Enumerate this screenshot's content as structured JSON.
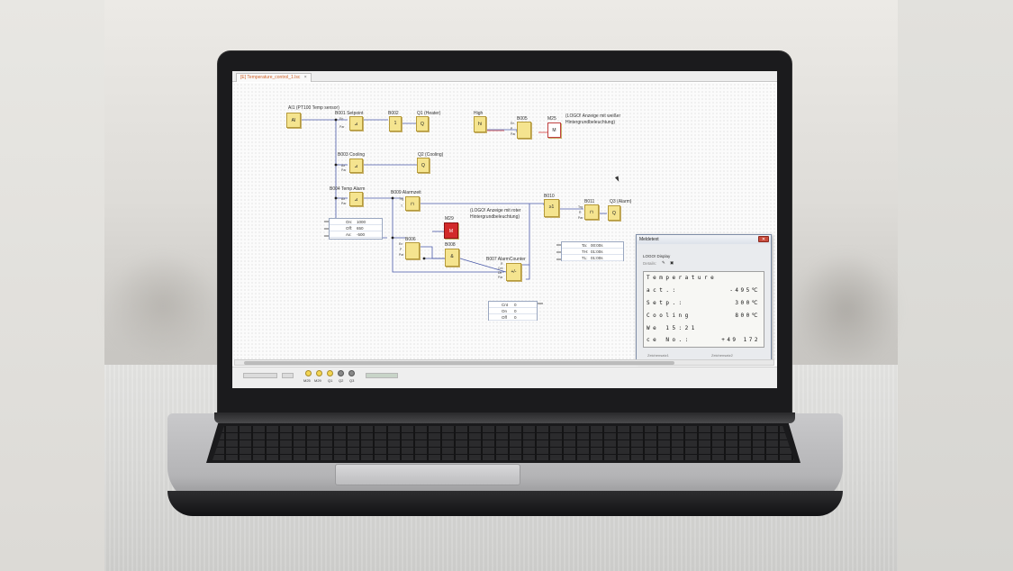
{
  "tab": {
    "label": "[E] Temperature_control_1.lsc",
    "close": "×"
  },
  "blocks": {
    "ai1": {
      "symbol": "AI",
      "label": "AI1 (PT100 Temp sensor)"
    },
    "b001": {
      "symbol": "⊿",
      "label": "B001 Setpoint",
      "pins": [
        "En",
        "Par"
      ]
    },
    "b002": {
      "symbol": "1",
      "label": "B002"
    },
    "q1": {
      "symbol": "Q",
      "label": "Q1 (Heater)"
    },
    "high": {
      "symbol": "hi",
      "label": "High"
    },
    "b005": {
      "symbol": "",
      "label": "B005",
      "pins": [
        "En",
        "P",
        "Par"
      ]
    },
    "m25": {
      "symbol": "M",
      "label": "M25"
    },
    "m25_note": "(LOGO! Anzeige mit weißer\nHintergrundbeleuchtung)",
    "b003": {
      "symbol": "⊿",
      "label": "B003 Cooling",
      "pins": [
        "Ax",
        "Par"
      ]
    },
    "q2": {
      "symbol": "Q",
      "label": "Q2 (Cooling)"
    },
    "b004": {
      "symbol": "⊿",
      "label": "B004 Temp Alarm",
      "pins": [
        "Ax",
        "Par"
      ]
    },
    "b009": {
      "symbol": "⊓",
      "label": "B009 Alarmzeit",
      "pins": [
        "Trg",
        "T"
      ]
    },
    "b010": {
      "symbol": "≥1",
      "label": "B010"
    },
    "b011": {
      "symbol": "⊓",
      "label": "B011",
      "pins": [
        "Trg",
        "R",
        "Par"
      ]
    },
    "q3": {
      "symbol": "Q",
      "label": "Q3 (Alarm)"
    },
    "m29": {
      "symbol": "M",
      "label": "M29"
    },
    "m29_note": "(LOGO! Anzeige mit roter\nHintergrundbeleuchtung)",
    "b006": {
      "symbol": "",
      "label": "B006",
      "pins": [
        "En",
        "P",
        "Par"
      ]
    },
    "b008": {
      "symbol": "&",
      "label": "B008"
    },
    "b007": {
      "symbol": "+/-",
      "label": "B007 AlarmCounter",
      "pins": [
        "R",
        "Cnt",
        "Dir",
        "Par"
      ]
    }
  },
  "params_b004": [
    {
      "key": "On:",
      "value": "1000"
    },
    {
      "key": "Off:",
      "value": "650"
    },
    {
      "key": "Ax:",
      "value": "-500"
    }
  ],
  "params_b011": [
    {
      "key": "Ta:",
      "value": "00:00s"
    },
    {
      "key": "TH:",
      "value": "01:00s"
    },
    {
      "key": "TL:",
      "value": "01:00s"
    }
  ],
  "params_b007": [
    {
      "key": "Cnt",
      "value": "0"
    },
    {
      "key": "On",
      "value": "0"
    },
    {
      "key": "Off",
      "value": "0"
    }
  ],
  "message_window": {
    "title": "Meldetext",
    "subtitle": "LOGO! Display",
    "details_label": "Details:",
    "lcd_rows": [
      {
        "label": "Temperature",
        "value": ""
      },
      {
        "label": "act.:",
        "value": "-495℃"
      },
      {
        "label": "Setp.:",
        "value": "300℃"
      },
      {
        "label": "Cooling",
        "value": "800℃"
      },
      {
        "label": "We 15:21",
        "value": ""
      },
      {
        "label": "ce No.:",
        "value": "+49 172"
      }
    ],
    "charset1": "Zeichensatz1",
    "charset2": "Zeichensatz2"
  },
  "statusbar": {
    "bulbs": [
      {
        "label": "M25",
        "on": true
      },
      {
        "label": "M29",
        "on": true
      },
      {
        "label": "Q1",
        "on": true
      },
      {
        "label": "Q2",
        "on": false
      },
      {
        "label": "Q3",
        "on": false
      }
    ]
  }
}
